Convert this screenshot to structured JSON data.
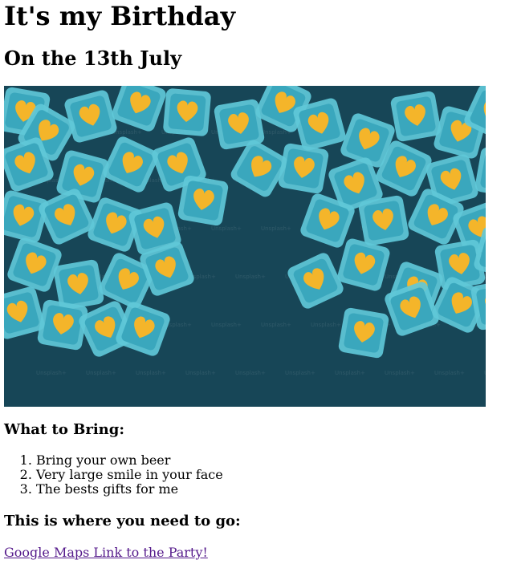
{
  "page": {
    "title": "It's my Birthday",
    "subtitle": "On the 13th July"
  },
  "hero_image": {
    "description": "",
    "watermark": "Unsplash+",
    "colors": {
      "background": "#174657",
      "tile": "#5fc8d8",
      "tile_inner": "#3aa7bd",
      "heart": "#f4b52a"
    }
  },
  "bring": {
    "heading": "What to Bring:",
    "items": [
      "Bring your own beer",
      "Very large smile in your face",
      "The bests gifts for me"
    ]
  },
  "location": {
    "heading": "This is where you need to go:",
    "link_text": "Google Maps Link to the Party!"
  }
}
